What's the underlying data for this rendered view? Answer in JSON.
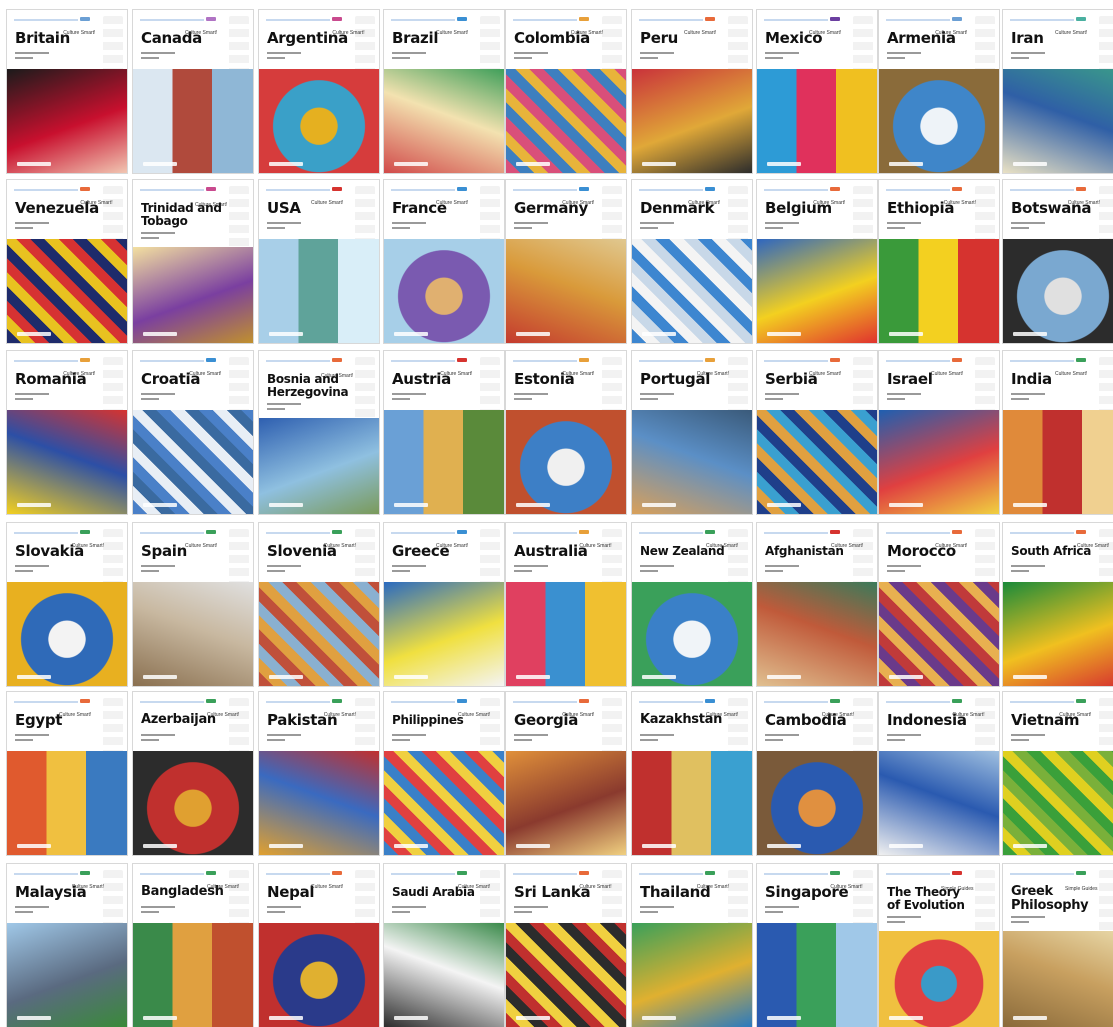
{
  "series_label": "Culture Smart!",
  "series_label_alt": "Simple Guides",
  "covers": [
    {
      "title": "Britain",
      "sub": "Culture Smart!",
      "colors": [
        "#1b1b1b",
        "#c8102e",
        "#f1c6b2"
      ],
      "tag": "#6b9fd4"
    },
    {
      "title": "Canada",
      "sub": "Culture Smart!",
      "colors": [
        "#dbe7f1",
        "#b04a3c",
        "#8fb7d6"
      ],
      "tag": "#b073c4"
    },
    {
      "title": "Argentina",
      "sub": "Culture Smart!",
      "colors": [
        "#3aa0c8",
        "#e5b020",
        "#d63c3c"
      ],
      "tag": "#c94a8e"
    },
    {
      "title": "Brazil",
      "sub": "Culture Smart!",
      "colors": [
        "#f3e2b0",
        "#d14a4a",
        "#3f9f5a"
      ],
      "tag": "#3a8fd3"
    },
    {
      "title": "Colombia",
      "sub": "Culture Smart!",
      "colors": [
        "#d94f7a",
        "#3d7fbf",
        "#e8b43a"
      ],
      "tag": "#e8a03a"
    },
    {
      "title": "Peru",
      "sub": "Culture Smart!",
      "colors": [
        "#c9323a",
        "#e0a838",
        "#2c2c2c"
      ],
      "tag": "#e86a3a"
    },
    {
      "title": "Mexico",
      "sub": "Culture Smart!",
      "colors": [
        "#2d9bd6",
        "#e0315c",
        "#f0c020"
      ],
      "tag": "#6b3fa0"
    },
    {
      "title": "Armenia",
      "sub": "Culture Smart!",
      "colors": [
        "#3f86c9",
        "#eef3f8",
        "#8a6b3a"
      ],
      "tag": "#6b9fd4"
    },
    {
      "title": "Iran",
      "sub": "Culture Smart!",
      "colors": [
        "#2f5fa6",
        "#e9e1c4",
        "#3a9a8a"
      ],
      "tag": "#4ab0a0"
    },
    {
      "title": "Venezuela",
      "sub": "Culture Smart!",
      "colors": [
        "#1e2b6b",
        "#e8c220",
        "#d63232"
      ],
      "tag": "#e86a3a"
    },
    {
      "title": "Trinidad and\nTobago",
      "sub": "Culture Smart!",
      "colors": [
        "#f3e0a0",
        "#7a3fa0",
        "#c0902e"
      ],
      "tag": "#c94a8e"
    },
    {
      "title": "USA",
      "sub": "Culture Smart!",
      "colors": [
        "#a8cfe8",
        "#5fa39a",
        "#d9eef8"
      ],
      "tag": "#d6332f"
    },
    {
      "title": "France",
      "sub": "Culture Smart!",
      "colors": [
        "#7a5ab0",
        "#e0b070",
        "#a7cfe8"
      ],
      "tag": "#3a8fd3"
    },
    {
      "title": "Germany",
      "sub": "Culture Smart!",
      "colors": [
        "#d99a3a",
        "#c43a2e",
        "#e0c890"
      ],
      "tag": "#3a8fd3"
    },
    {
      "title": "Denmark",
      "sub": "Culture Smart!",
      "colors": [
        "#3d86d0",
        "#f4f4f4",
        "#c8d8e8"
      ],
      "tag": "#3a8fd3"
    },
    {
      "title": "Belgium",
      "sub": "Culture Smart!",
      "colors": [
        "#2e66c0",
        "#f3d020",
        "#e0332e"
      ],
      "tag": "#e86a3a"
    },
    {
      "title": "Ethiopia",
      "sub": "Culture Smart!",
      "colors": [
        "#3a9a3a",
        "#f3d020",
        "#d6332f"
      ],
      "tag": "#e86a3a"
    },
    {
      "title": "Botswana",
      "sub": "Culture Smart!",
      "colors": [
        "#7aa8d0",
        "#e0e0e0",
        "#2c2c2c"
      ],
      "tag": "#e86a3a"
    },
    {
      "title": "Romania",
      "sub": "Culture Smart!",
      "colors": [
        "#2c4fa6",
        "#f3d020",
        "#d6332f"
      ],
      "tag": "#e8a03a"
    },
    {
      "title": "Croatia",
      "sub": "Culture Smart!",
      "colors": [
        "#4a80c8",
        "#e8eef5",
        "#3a6aa0"
      ],
      "tag": "#3a8fd3"
    },
    {
      "title": "Bosnia and\nHerzegovina",
      "sub": "Culture Smart!",
      "colors": [
        "#2e5fb0",
        "#8fc0e0",
        "#7a9a5a"
      ],
      "tag": "#e86a3a"
    },
    {
      "title": "Austria",
      "sub": "Culture Smart!",
      "colors": [
        "#6aa0d6",
        "#e0b050",
        "#5a8a3a"
      ],
      "tag": "#d6332f"
    },
    {
      "title": "Estonia",
      "sub": "Culture Smart!",
      "colors": [
        "#3d7fc6",
        "#f0f0f0",
        "#c0502e"
      ],
      "tag": "#e8a03a"
    },
    {
      "title": "Portugal",
      "sub": "Culture Smart!",
      "colors": [
        "#5b8fc6",
        "#d9a05a",
        "#3a5a7a"
      ],
      "tag": "#e8a03a"
    },
    {
      "title": "Serbia",
      "sub": "Culture Smart!",
      "colors": [
        "#1f3f8a",
        "#e0a040",
        "#3aa0d0"
      ],
      "tag": "#e86a3a"
    },
    {
      "title": "Israel",
      "sub": "Culture Smart!",
      "colors": [
        "#1f5fb0",
        "#e04040",
        "#f0d040"
      ],
      "tag": "#e86a3a"
    },
    {
      "title": "India",
      "sub": "Culture Smart!",
      "colors": [
        "#e08a3a",
        "#c0302e",
        "#f0d090"
      ],
      "tag": "#3aa05a"
    },
    {
      "title": "Slovakia",
      "sub": "Culture Smart!",
      "colors": [
        "#2f6ab8",
        "#f3f3f3",
        "#e8b020"
      ],
      "tag": "#3aa05a"
    },
    {
      "title": "Spain",
      "sub": "Culture Smart!",
      "colors": [
        "#c8b8a0",
        "#8a7050",
        "#e0e0e0"
      ],
      "tag": "#3aa05a"
    },
    {
      "title": "Slovenia",
      "sub": "Culture Smart!",
      "colors": [
        "#c0503a",
        "#e0a040",
        "#8ab0d0"
      ],
      "tag": "#3aa05a"
    },
    {
      "title": "Greece",
      "sub": "Culture Smart!",
      "colors": [
        "#2a6ac0",
        "#f0e040",
        "#f4f4f4"
      ],
      "tag": "#3a8fd3"
    },
    {
      "title": "Australia",
      "sub": "Culture Smart!",
      "colors": [
        "#e04060",
        "#3a90d0",
        "#f0c030"
      ],
      "tag": "#e8a03a"
    },
    {
      "title": "New Zealand",
      "sub": "Culture Smart!",
      "colors": [
        "#3a80c8",
        "#f0f4f8",
        "#3aa05a"
      ],
      "tag": "#3aa05a"
    },
    {
      "title": "Afghanistan",
      "sub": "Culture Smart!",
      "colors": [
        "#c05a3a",
        "#e0c090",
        "#3a7a5a"
      ],
      "tag": "#d6332f"
    },
    {
      "title": "Morocco",
      "sub": "Culture Smart!",
      "colors": [
        "#c03a3a",
        "#e8b050",
        "#6a3a8a"
      ],
      "tag": "#e86a3a"
    },
    {
      "title": "South Africa",
      "sub": "Culture Smart!",
      "colors": [
        "#1a8a3a",
        "#f0c020",
        "#d6332f"
      ],
      "tag": "#e86a3a"
    },
    {
      "title": "Egypt",
      "sub": "Culture Smart!",
      "colors": [
        "#e05a2e",
        "#f0c040",
        "#3a7ac0"
      ],
      "tag": "#e86a3a"
    },
    {
      "title": "Azerbaijan",
      "sub": "Culture Smart!",
      "colors": [
        "#c0302e",
        "#e0a030",
        "#2c2c2c"
      ],
      "tag": "#3aa05a"
    },
    {
      "title": "Pakistan",
      "sub": "Culture Smart!",
      "colors": [
        "#3a6ac0",
        "#e0a030",
        "#c0302e"
      ],
      "tag": "#3aa05a"
    },
    {
      "title": "Philippines",
      "sub": "Culture Smart!",
      "colors": [
        "#3a80c8",
        "#e04040",
        "#f0d040"
      ],
      "tag": "#3a8fd3"
    },
    {
      "title": "Georgia",
      "sub": "Culture Smart!",
      "colors": [
        "#e0903a",
        "#8a3a2e",
        "#f0d080"
      ],
      "tag": "#e86a3a"
    },
    {
      "title": "Kazakhstan",
      "sub": "Culture Smart!",
      "colors": [
        "#c0302e",
        "#e0c060",
        "#3aa0d0"
      ],
      "tag": "#3a8fd3"
    },
    {
      "title": "Cambodia",
      "sub": "Culture Smart!",
      "colors": [
        "#2a5ab0",
        "#e09040",
        "#7a5a3a"
      ],
      "tag": "#3aa05a"
    },
    {
      "title": "Indonesia",
      "sub": "Culture Smart!",
      "colors": [
        "#2a5ab0",
        "#f0f0f0",
        "#a0c0e0"
      ],
      "tag": "#3aa05a"
    },
    {
      "title": "Vietnam",
      "sub": "Culture Smart!",
      "colors": [
        "#3aa03a",
        "#e0d020",
        "#7ab03a"
      ],
      "tag": "#3aa05a"
    },
    {
      "title": "Malaysia",
      "sub": "Culture Smart!",
      "colors": [
        "#a0c8e8",
        "#5a6a80",
        "#3a8a3a"
      ],
      "tag": "#3aa05a"
    },
    {
      "title": "Bangladesh",
      "sub": "Culture Smart!",
      "colors": [
        "#3a8a4a",
        "#e0a040",
        "#c0502e"
      ],
      "tag": "#3aa05a"
    },
    {
      "title": "Nepal",
      "sub": "Culture Smart!",
      "colors": [
        "#2a3a8a",
        "#e0b030",
        "#c0302e"
      ],
      "tag": "#e86a3a"
    },
    {
      "title": "Saudi Arabia",
      "sub": "Culture Smart!",
      "colors": [
        "#f4f4f4",
        "#2c2c2c",
        "#3a8a4a"
      ],
      "tag": "#3aa05a"
    },
    {
      "title": "Sri Lanka",
      "sub": "Culture Smart!",
      "colors": [
        "#c0302e",
        "#f0d040",
        "#2c2c2c"
      ],
      "tag": "#e86a3a"
    },
    {
      "title": "Thailand",
      "sub": "Culture Smart!",
      "colors": [
        "#3aa05a",
        "#e0b030",
        "#2a7ac0"
      ],
      "tag": "#3aa05a"
    },
    {
      "title": "Singapore",
      "sub": "Culture Smart!",
      "colors": [
        "#2a5ab0",
        "#3aa05a",
        "#a0c8e8"
      ],
      "tag": "#3aa05a"
    },
    {
      "title": "The Theory\nof Evolution",
      "sub": "Simple Guides",
      "colors": [
        "#e04040",
        "#3a9ac8",
        "#f0c040"
      ],
      "tag": "#d6332f"
    },
    {
      "title": "Greek\nPhilosophy",
      "sub": "Simple Guides",
      "colors": [
        "#c8a060",
        "#8a6a3a",
        "#e8d8a8"
      ],
      "tag": "#3aa05a"
    }
  ]
}
